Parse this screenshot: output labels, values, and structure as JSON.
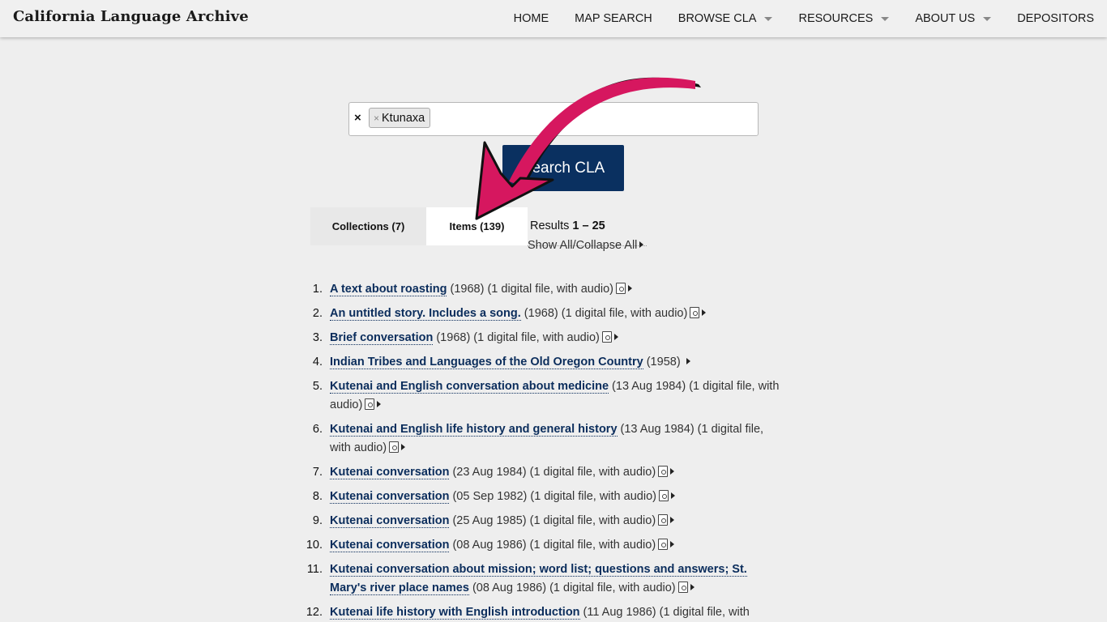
{
  "site": {
    "title": "California Language Archive"
  },
  "nav": [
    {
      "label": "HOME",
      "dropdown": false
    },
    {
      "label": "MAP SEARCH",
      "dropdown": false
    },
    {
      "label": "BROWSE CLA",
      "dropdown": true
    },
    {
      "label": "RESOURCES",
      "dropdown": true
    },
    {
      "label": "ABOUT US",
      "dropdown": true
    },
    {
      "label": "DEPOSITORS",
      "dropdown": false
    }
  ],
  "search": {
    "clear_symbol": "×",
    "chip_remove_symbol": "×",
    "chip_value": "Ktunaxa",
    "button_label": "Search CLA"
  },
  "tabs": {
    "collections": "Collections (7)",
    "items": "Items (139)",
    "active": "items"
  },
  "results_summary": {
    "prefix": "Results ",
    "range": "1 – 25",
    "show_all": "Show All/Collapse All"
  },
  "results": [
    {
      "num": "1.",
      "title": "A text about roasting",
      "meta": " (1968) (1 digital file, with audio)",
      "has_file": true
    },
    {
      "num": "2.",
      "title": "An untitled story. Includes a song.",
      "meta": " (1968) (1 digital file, with audio)",
      "has_file": true
    },
    {
      "num": "3.",
      "title": "Brief conversation",
      "meta": " (1968) (1 digital file, with audio)",
      "has_file": true
    },
    {
      "num": "4.",
      "title": "Indian Tribes and Languages of the Old Oregon Country",
      "meta": " (1958) ",
      "has_file": false
    },
    {
      "num": "5.",
      "title": "Kutenai and English conversation about medicine",
      "meta": " (13 Aug 1984) (1 digital file, with audio)",
      "has_file": true
    },
    {
      "num": "6.",
      "title": "Kutenai and English life history and general history",
      "meta": " (13 Aug 1984) (1 digital file, with audio)",
      "has_file": true
    },
    {
      "num": "7.",
      "title": "Kutenai conversation",
      "meta": " (23 Aug 1984) (1 digital file, with audio)",
      "has_file": true
    },
    {
      "num": "8.",
      "title": "Kutenai conversation",
      "meta": " (05 Sep 1982) (1 digital file, with audio)",
      "has_file": true
    },
    {
      "num": "9.",
      "title": "Kutenai conversation",
      "meta": " (25 Aug 1985) (1 digital file, with audio)",
      "has_file": true
    },
    {
      "num": "10.",
      "title": "Kutenai conversation",
      "meta": " (08 Aug 1986) (1 digital file, with audio)",
      "has_file": true
    },
    {
      "num": "11.",
      "title": "Kutenai conversation about mission; word list; questions and answers; St. Mary's river place names",
      "meta": " (08 Aug 1986) (1 digital file, with audio)",
      "has_file": true
    },
    {
      "num": "12.",
      "title": "Kutenai life history with English introduction",
      "meta": " (11 Aug 1986) (1 digital file, with",
      "has_file": false
    }
  ],
  "annotation": {
    "arrow_color": "#d6175f"
  }
}
